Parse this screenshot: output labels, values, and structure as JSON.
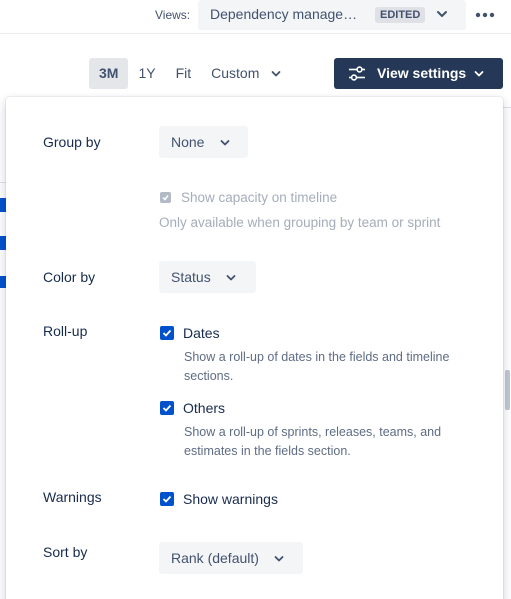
{
  "header": {
    "views_label": "Views:",
    "view_name": "Dependency manage…",
    "edited_badge": "EDITED",
    "more_icon": "more-horizontal-icon"
  },
  "toolbar": {
    "ranges": [
      "3M",
      "1Y",
      "Fit",
      "Custom"
    ],
    "active_range": "3M",
    "view_settings_label": "View settings"
  },
  "panel": {
    "group_by": {
      "label": "Group by",
      "value": "None",
      "capacity_checkbox": {
        "label": "Show capacity on timeline",
        "checked": true,
        "disabled": true,
        "helper": "Only available when grouping by team or sprint"
      }
    },
    "color_by": {
      "label": "Color by",
      "value": "Status"
    },
    "roll_up": {
      "label": "Roll-up",
      "options": [
        {
          "label": "Dates",
          "checked": true,
          "helper_line1": "Show a roll-up of dates in the fields and timeline",
          "helper_line2": "sections."
        },
        {
          "label": "Others",
          "checked": true,
          "helper_line1": "Show a roll-up of sprints, releases, teams, and",
          "helper_line2": "estimates in the fields section."
        }
      ]
    },
    "warnings": {
      "label": "Warnings",
      "checkbox_label": "Show warnings",
      "checked": true
    },
    "sort_by": {
      "label": "Sort by",
      "value": "Rank (default)"
    }
  },
  "colors": {
    "primary_button": "#253858",
    "checkbox": "#0052cc",
    "checkbox_disabled": "#b3bac5"
  }
}
